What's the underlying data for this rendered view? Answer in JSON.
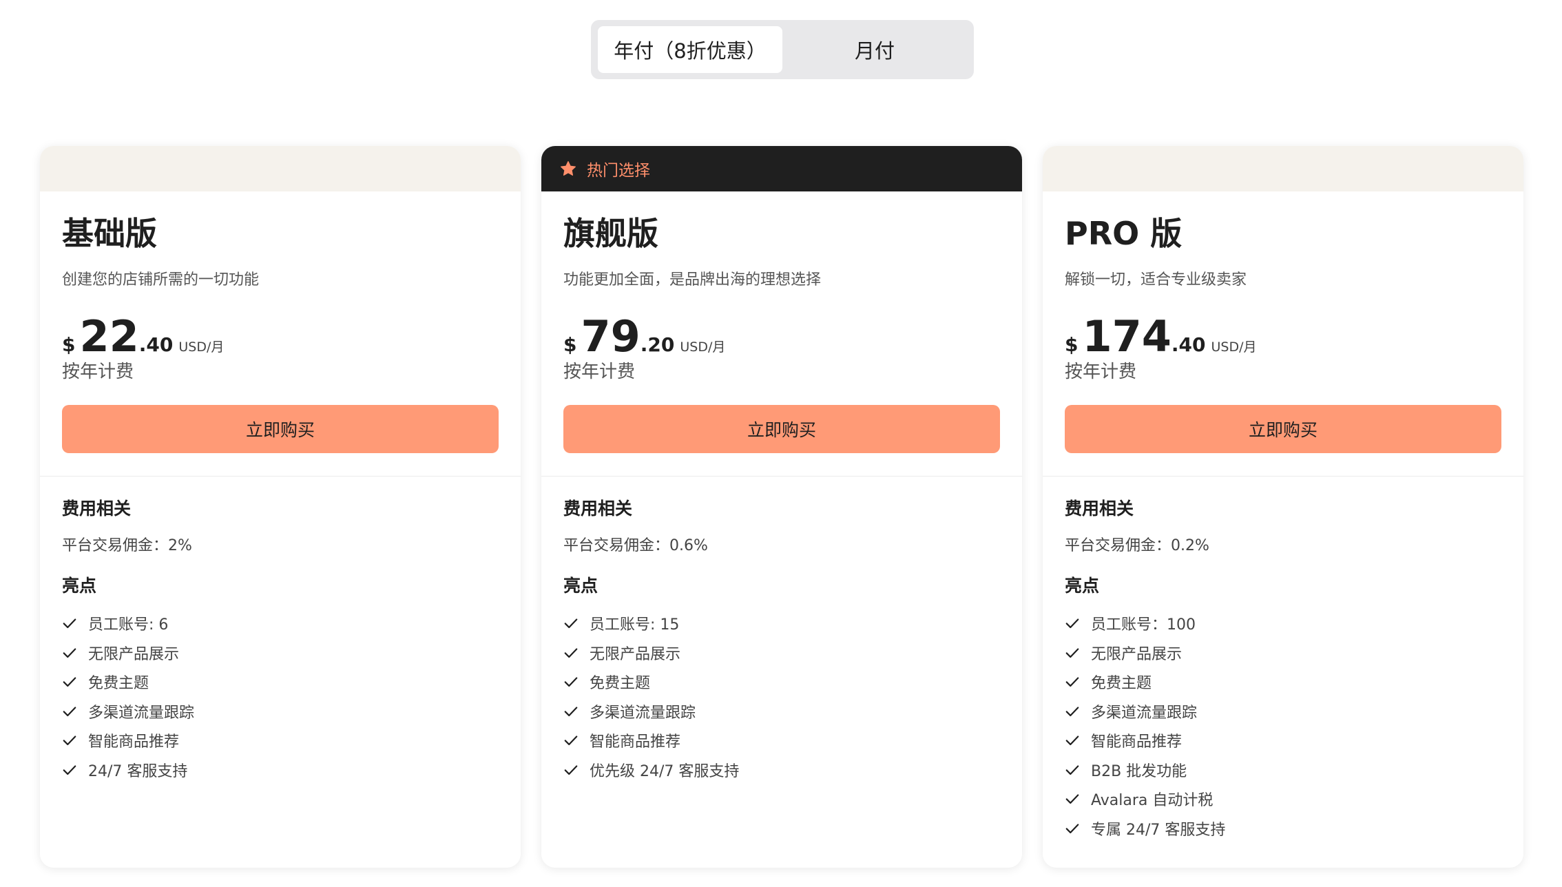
{
  "billing_toggle": {
    "options": [
      {
        "label": "年付（8折优惠）",
        "active": true
      },
      {
        "label": "月付",
        "active": false
      }
    ]
  },
  "colors": {
    "accent": "#ff9a76",
    "popular_banner_bg": "#1f1f1f",
    "popular_text": "#ff8f6b",
    "card_top_bg": "#f5f2ec"
  },
  "plans": [
    {
      "name": "基础版",
      "description": "创建您的店铺所需的一切功能",
      "currency": "$",
      "price_int": "22",
      "price_dec": ".40",
      "unit": "USD/月",
      "billing_note": "按年计费",
      "cta": "立即购买",
      "fees_title": "费用相关",
      "commission": "平台交易佣金：2%",
      "highlights_title": "亮点",
      "features": [
        "员工账号: 6",
        "无限产品展示",
        "免费主题",
        "多渠道流量跟踪",
        "智能商品推荐",
        "24/7 客服支持"
      ]
    },
    {
      "name": "旗舰版",
      "badge": {
        "icon": "star-icon",
        "label": "热门选择"
      },
      "description": "功能更加全面，是品牌出海的理想选择",
      "currency": "$",
      "price_int": "79",
      "price_dec": ".20",
      "unit": "USD/月",
      "billing_note": "按年计费",
      "cta": "立即购买",
      "fees_title": "费用相关",
      "commission": "平台交易佣金：0.6%",
      "highlights_title": "亮点",
      "features": [
        "员工账号: 15",
        "无限产品展示",
        "免费主题",
        "多渠道流量跟踪",
        "智能商品推荐",
        "优先级 24/7 客服支持"
      ]
    },
    {
      "name": "PRO 版",
      "description": "解锁一切，适合专业级卖家",
      "currency": "$",
      "price_int": "174",
      "price_dec": ".40",
      "unit": "USD/月",
      "billing_note": "按年计费",
      "cta": "立即购买",
      "fees_title": "费用相关",
      "commission": "平台交易佣金：0.2%",
      "highlights_title": "亮点",
      "features": [
        "员工账号：100",
        "无限产品展示",
        "免费主题",
        "多渠道流量跟踪",
        "智能商品推荐",
        "B2B 批发功能",
        "Avalara 自动计税",
        "专属 24/7 客服支持"
      ]
    }
  ]
}
